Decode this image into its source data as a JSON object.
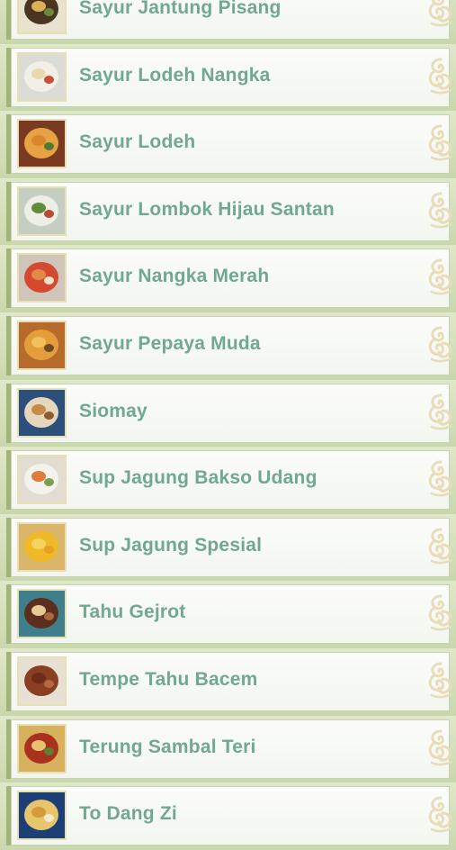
{
  "recipes": [
    {
      "name": "Sayur Jantung Pisang",
      "thumb": {
        "bg": "#e9e2cf",
        "plate": "#4a3523",
        "b1": "#d9b15a",
        "b2": "#6b8a3c"
      }
    },
    {
      "name": "Sayur Lodeh Nangka",
      "thumb": {
        "bg": "#dcdcd6",
        "plate": "#f1efe6",
        "b1": "#e9d9b0",
        "b2": "#c94b3a"
      }
    },
    {
      "name": "Sayur Lodeh",
      "thumb": {
        "bg": "#7a3a22",
        "plate": "#e7a343",
        "b1": "#d8872d",
        "b2": "#4f7a32"
      }
    },
    {
      "name": "Sayur Lombok Hijau Santan",
      "thumb": {
        "bg": "#c4cfc1",
        "plate": "#eeeee6",
        "b1": "#5e8d3b",
        "b2": "#b94a35"
      }
    },
    {
      "name": "Sayur Nangka Merah",
      "thumb": {
        "bg": "#cfc5b8",
        "plate": "#d4492f",
        "b1": "#e08a4a",
        "b2": "#f2e3c6"
      }
    },
    {
      "name": "Sayur Pepaya Muda",
      "thumb": {
        "bg": "#b66a2c",
        "plate": "#e39d3b",
        "b1": "#f2c25a",
        "b2": "#6c4a22"
      }
    },
    {
      "name": "Siomay",
      "thumb": {
        "bg": "#2d4f7c",
        "plate": "#e4d7bd",
        "b1": "#c68a4a",
        "b2": "#8c5b30"
      }
    },
    {
      "name": "Sup Jagung Bakso Udang",
      "thumb": {
        "bg": "#e2ddd0",
        "plate": "#f3f2ec",
        "b1": "#e07a3c",
        "b2": "#79a04e"
      }
    },
    {
      "name": "Sup Jagung Spesial",
      "thumb": {
        "bg": "#d9b66a",
        "plate": "#f0b928",
        "b1": "#f6d360",
        "b2": "#e79f1f"
      }
    },
    {
      "name": "Tahu Gejrot",
      "thumb": {
        "bg": "#3f7f8c",
        "plate": "#5b2e1e",
        "b1": "#e8c995",
        "b2": "#a86a3a"
      }
    },
    {
      "name": "Tempe Tahu Bacem",
      "thumb": {
        "bg": "#e7e1d4",
        "plate": "#8a3f23",
        "b1": "#6b2d18",
        "b2": "#b5693a"
      }
    },
    {
      "name": "Terung Sambal Teri",
      "thumb": {
        "bg": "#d7b15e",
        "plate": "#a8321f",
        "b1": "#e7c26d",
        "b2": "#5e7f2f"
      }
    },
    {
      "name": "To Dang Zi",
      "thumb": {
        "bg": "#1c3f76",
        "plate": "#e7c56d",
        "b1": "#d49a3b",
        "b2": "#f3e8c8"
      }
    }
  ],
  "ornament_icon": "floral-swirl-icon",
  "colors": {
    "label": "#70a891",
    "ornament": "#e8dcb9",
    "row_strip": "#9fb57a"
  }
}
